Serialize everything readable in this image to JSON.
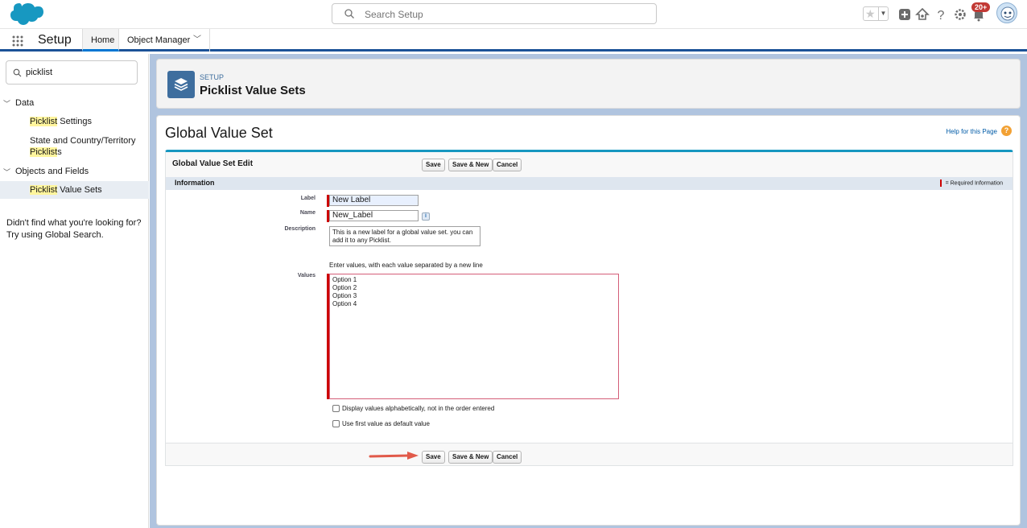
{
  "topbar": {
    "search_placeholder": "Search Setup",
    "notification_badge": "20+",
    "icons": [
      "salesforce-cloud-logo",
      "star-icon",
      "add-icon",
      "trailhead-icon",
      "help-icon",
      "gear-icon",
      "bell-icon",
      "avatar"
    ]
  },
  "nav": {
    "app_name": "Setup",
    "tabs": [
      {
        "label": "Home"
      },
      {
        "label": "Object Manager"
      }
    ]
  },
  "sidebar": {
    "search_value": "picklist",
    "groups": [
      {
        "label": "Data"
      },
      {
        "label": "Objects and Fields"
      }
    ],
    "items": [
      {
        "hl": "Picklist",
        "rest": " Settings"
      },
      {
        "pre": "State and Country/Territory",
        "hl": "Picklist",
        "post": "s"
      },
      {
        "hl": "Picklist",
        "rest": " Value Sets"
      }
    ],
    "note_line1": "Didn't find what you're looking for?",
    "note_line2": "Try using Global Search."
  },
  "header": {
    "small": "SETUP",
    "title": "Picklist Value Sets"
  },
  "page": {
    "title": "Global Value Set",
    "help_link": "Help for this Page",
    "help_icon": "?"
  },
  "form": {
    "block_title": "Global Value Set Edit",
    "buttons": {
      "save": "Save",
      "save_new": "Save & New",
      "cancel": "Cancel"
    },
    "section_title": "Information",
    "required_legend": "= Required Information",
    "fields": {
      "label_label": "Label",
      "label_value": "New Label",
      "name_label": "Name",
      "name_value": "New_Label",
      "description_label": "Description",
      "description_value": "This is a new label for a global value set. you can add it to any Picklist.",
      "values_hint": "Enter values, with each value separated by a new line",
      "values_label": "Values",
      "values": [
        "Option 1",
        "Option 2",
        "Option 3",
        "Option 4"
      ]
    },
    "checkboxes": {
      "alpha": "Display values alphabetically, not in the order entered",
      "default_first": "Use first value as default value"
    }
  }
}
